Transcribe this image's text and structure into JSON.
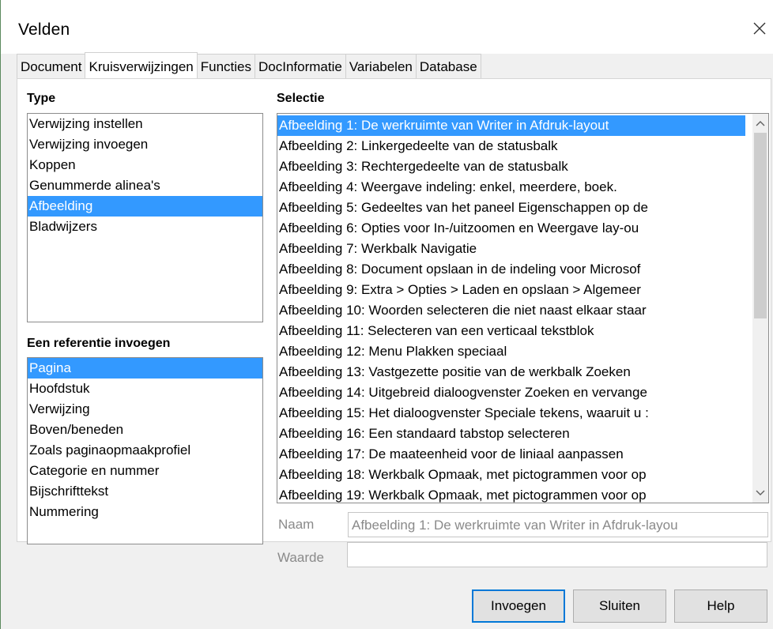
{
  "window": {
    "title": "Velden"
  },
  "tabs": [
    "Document",
    "Kruisverwijzingen",
    "Functies",
    "DocInformatie",
    "Variabelen",
    "Database"
  ],
  "active_tab": "Kruisverwijzingen",
  "type_section": {
    "label": "Type",
    "items": [
      "Verwijzing instellen",
      "Verwijzing invoegen",
      "Koppen",
      "Genummerde alinea's",
      "Afbeelding",
      "Bladwijzers"
    ],
    "selected": "Afbeelding"
  },
  "reference_section": {
    "label": "Een referentie invoegen",
    "items": [
      "Pagina",
      "Hoofdstuk",
      "Verwijzing",
      "Boven/beneden",
      "Zoals paginaopmaakprofiel",
      "Categorie en nummer",
      "Bijschrifttekst",
      "Nummering"
    ],
    "selected": "Pagina"
  },
  "selection_section": {
    "label": "Selectie",
    "items": [
      "Afbeelding 1: De werkruimte van Writer in Afdruk-layout",
      "Afbeelding 2: Linkergedeelte van de statusbalk",
      "Afbeelding 3: Rechtergedeelte van de statusbalk",
      "Afbeelding 4: Weergave indeling: enkel, meerdere, boek.",
      "Afbeelding 5: Gedeeltes van het paneel Eigenschappen op de",
      "Afbeelding 6: Opties voor In-/uitzoomen en Weergave lay-ou",
      "Afbeelding 7: Werkbalk Navigatie",
      "Afbeelding 8: Document opslaan in de indeling voor Microsof",
      "Afbeelding 9: Extra > Opties > Laden en opslaan > Algemeer",
      "Afbeelding 10: Woorden selecteren die niet naast elkaar staar",
      "Afbeelding 11: Selecteren van een verticaal tekstblok",
      "Afbeelding 12: Menu Plakken speciaal",
      "Afbeelding 13: Vastgezette positie van de werkbalk Zoeken",
      "Afbeelding 14: Uitgebreid dialoogvenster Zoeken en vervange",
      "Afbeelding 15: Het dialoogvenster Speciale tekens, waaruit u :",
      "Afbeelding 16: Een standaard tabstop selecteren",
      "Afbeelding 17: De maateenheid voor de liniaal aanpassen",
      "Afbeelding 18: Werkbalk Opmaak, met pictogrammen voor op",
      "Afbeelding 19: Werkbalk Opmaak, met pictogrammen voor op"
    ],
    "selected_index": 0
  },
  "fields": {
    "naam_label": "Naam",
    "naam_value": "Afbeelding 1: De werkruimte van Writer in Afdruk-layou",
    "waarde_label": "Waarde",
    "waarde_value": ""
  },
  "buttons": {
    "insert": "Invoegen",
    "close": "Sluiten",
    "help": "Help"
  },
  "icons": {
    "close": "close-icon",
    "scroll_up": "chevron-up-icon",
    "scroll_down": "chevron-down-icon"
  },
  "colors": {
    "selection": "#3399ff",
    "default_button_border": "#0078d7"
  }
}
